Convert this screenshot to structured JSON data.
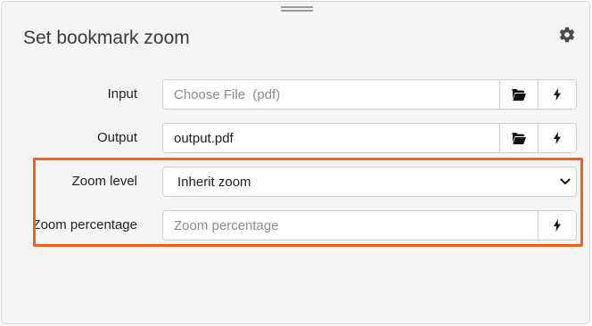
{
  "window": {
    "title": "Set bookmark zoom",
    "settings_icon": "gear-icon"
  },
  "form": {
    "input": {
      "label": "Input",
      "placeholder": "Choose File  (pdf)",
      "value": "",
      "browse_icon": "folder-open-icon",
      "action_icon": "bolt-icon"
    },
    "output": {
      "label": "Output",
      "value": "output.pdf",
      "browse_icon": "folder-open-icon",
      "action_icon": "bolt-icon"
    },
    "zoom_level": {
      "label": "Zoom level",
      "selected": "Inherit zoom",
      "dropdown_icon": "chevron-down-icon"
    },
    "zoom_percentage": {
      "label": "Zoom percentage",
      "placeholder": "Zoom percentage",
      "value": "",
      "action_icon": "bolt-icon"
    }
  },
  "highlight_color": "#f2601c"
}
